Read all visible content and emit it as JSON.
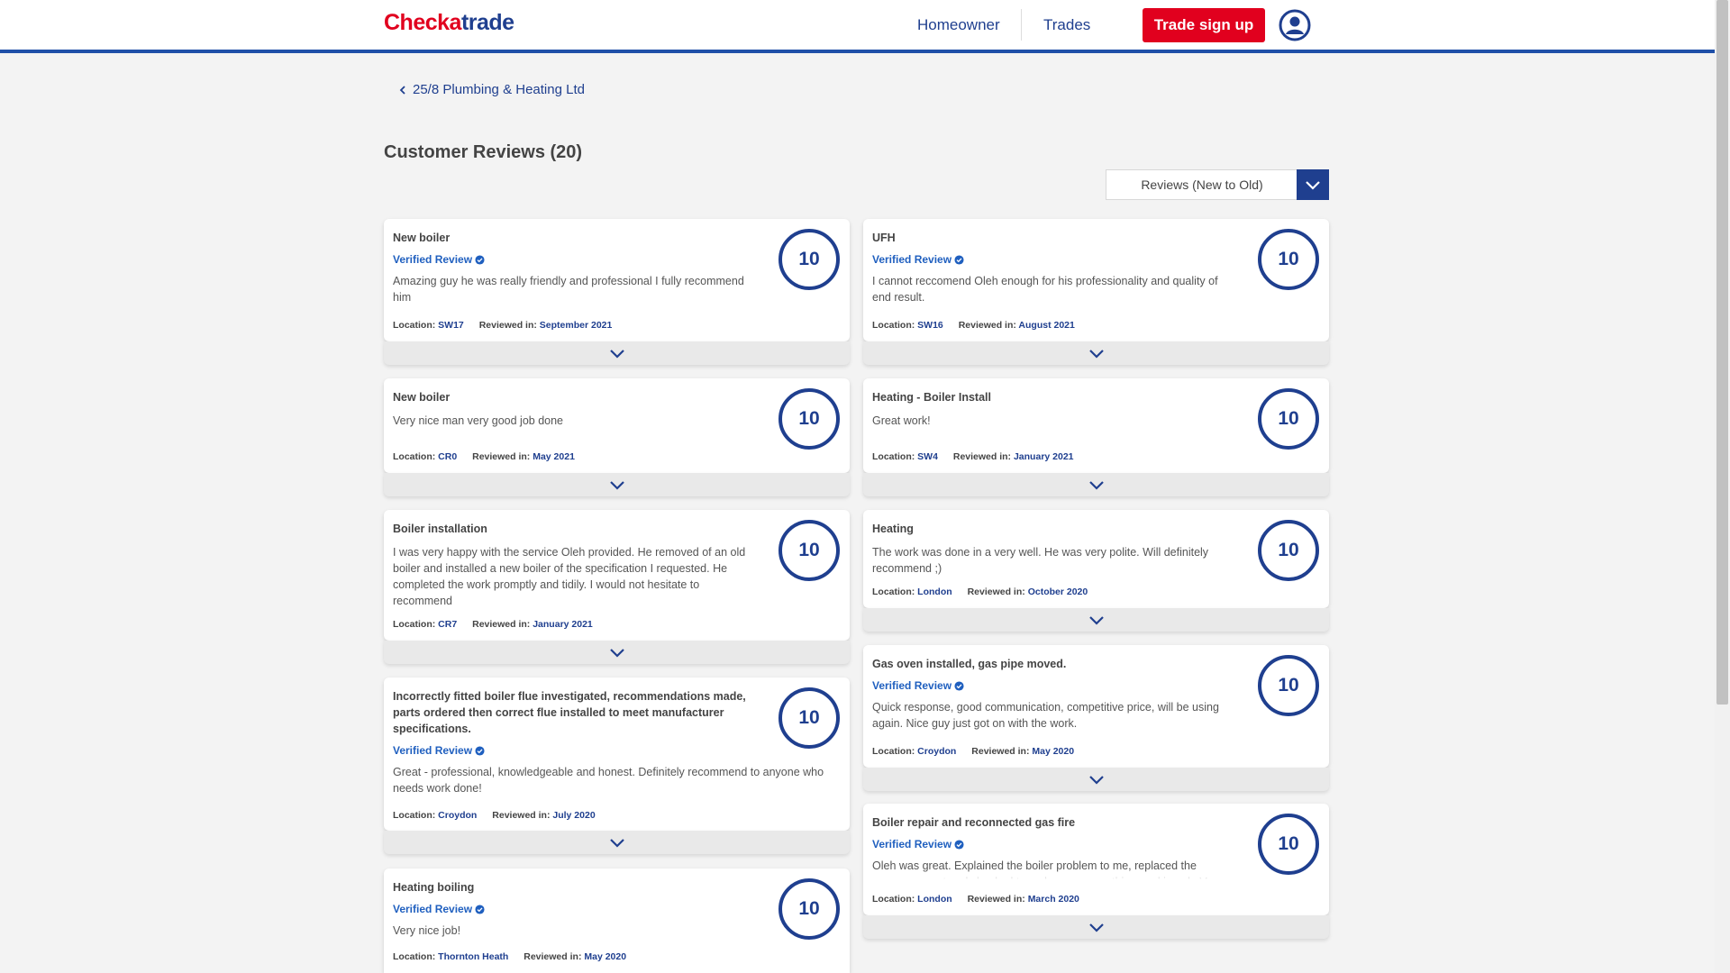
{
  "brand": {
    "logo_part1": "Checka",
    "logo_part2": "trade",
    "red": "#e1001e",
    "blue": "#1f3f8f"
  },
  "nav": {
    "homeowner": "Homeowner",
    "trades": "Trades",
    "trade_signup": "Trade sign up",
    "account_icon": "user-circle-icon"
  },
  "breadcrumb": {
    "back_icon": "chevron-left-icon",
    "label": "25/8 Plumbing & Heating Ltd"
  },
  "page": {
    "title": "Customer Reviews (20)"
  },
  "sort": {
    "selected": "Reviews (New to Old)"
  },
  "review_labels": {
    "verified": "Verified Review",
    "location": "Location:",
    "reviewed_in": "Reviewed in:"
  },
  "reviews_left": [
    {
      "title": "New boiler",
      "verified": true,
      "text": "Amazing guy he was really friendly and professional I fully recommend him",
      "location": "SW17",
      "date": "September 2021",
      "score": "10"
    },
    {
      "title": "New boiler",
      "verified": false,
      "text": "Very nice man very good job done",
      "location": "CR0",
      "date": "May 2021",
      "score": "10"
    },
    {
      "title": "Boiler installation",
      "verified": false,
      "text": "I was very happy with the service Oleh provided. He removed of an old boiler and installed a new boiler of the specification I requested. He completed the work promptly and tidily. I would not hesitate to recommend",
      "location": "CR7",
      "date": "January 2021",
      "score": "10"
    },
    {
      "title": "Incorrectly fitted boiler flue investigated, recommendations made, parts ordered then correct flue installed to meet manufacturer specifications.",
      "verified": true,
      "text": "Great - professional, knowledgeable and honest. Definitely recommend to anyone who needs work done!",
      "location": "Croydon",
      "date": "July 2020",
      "score": "10"
    },
    {
      "title": "Heating boiling",
      "verified": true,
      "text": "Very nice job!",
      "location": "Thornton Heath",
      "date": "May 2020",
      "score": "10"
    }
  ],
  "reviews_right": [
    {
      "title": "UFH",
      "verified": true,
      "text": "I cannot reccomend Oleh enough for his professionality and quality of end result.",
      "location": "SW16",
      "date": "August 2021",
      "score": "10"
    },
    {
      "title": "Heating - Boiler Install",
      "verified": false,
      "text": "Great work!",
      "location": "SW4",
      "date": "January 2021",
      "score": "10"
    },
    {
      "title": "Heating",
      "verified": false,
      "text": "The work was done in a very well. He was very polite. Will definitely recommend ;)",
      "location": "London",
      "date": "October 2020",
      "score": "10"
    },
    {
      "title": "Gas oven installed, gas pipe moved.",
      "verified": true,
      "text": "Quick response, good communication, competitive price, will be using again. Nice guy just got on with the work.",
      "location": "Croydon",
      "date": "May 2020",
      "score": "10"
    },
    {
      "title": "Boiler repair and reconnected gas fire",
      "verified": true,
      "text": "Oleh was great. Explained the boiler problem to me, replaced the necessary part and checked to make sure everything working ok. Very honest and",
      "location": "London",
      "date": "March 2020",
      "score": "10"
    }
  ]
}
